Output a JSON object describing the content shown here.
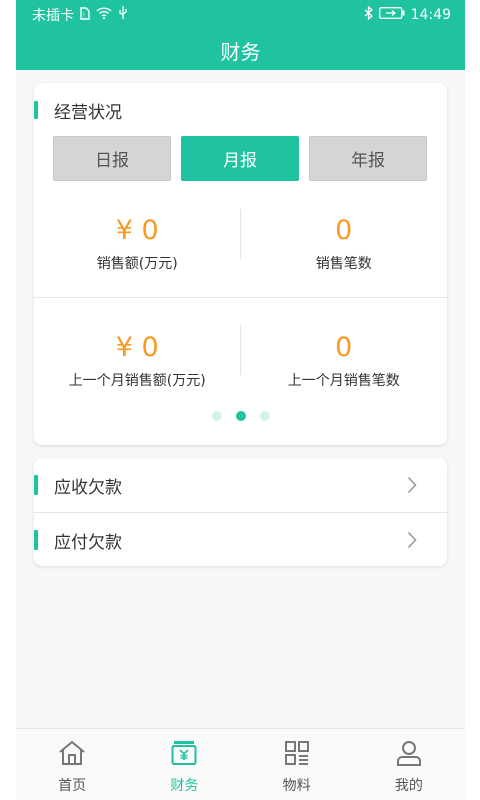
{
  "status_bar": {
    "carrier": "未插卡",
    "time": "14:49"
  },
  "header": {
    "title": "财务"
  },
  "operations": {
    "title": "经营状况",
    "segments": [
      "日报",
      "月报",
      "年报"
    ],
    "selected_segment": "月报",
    "current": {
      "sales_value": "¥ 0",
      "sales_label": "销售额(万元)",
      "count_value": "0",
      "count_label": "销售笔数"
    },
    "previous": {
      "sales_value": "¥ 0",
      "sales_label": "上一个月销售额(万元)",
      "count_value": "0",
      "count_label": "上一个月销售笔数"
    },
    "pager": {
      "total": 3,
      "active_index": 1
    }
  },
  "debts": {
    "receivable": "应收欠款",
    "payable": "应付欠款"
  },
  "tabs": [
    {
      "label": "首页",
      "icon": "home-icon"
    },
    {
      "label": "财务",
      "icon": "finance-icon"
    },
    {
      "label": "物料",
      "icon": "materials-icon"
    },
    {
      "label": "我的",
      "icon": "profile-icon"
    }
  ],
  "active_tab": "财务",
  "colors": {
    "accent": "#1fc3a0",
    "value": "#f59a23"
  }
}
